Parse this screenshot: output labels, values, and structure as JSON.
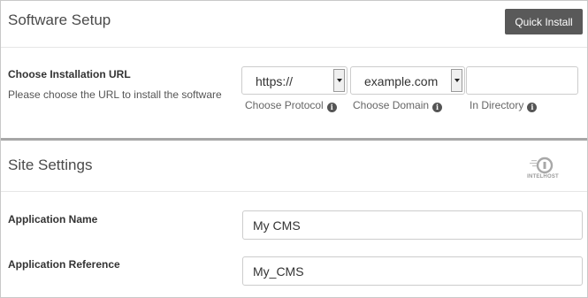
{
  "software_setup": {
    "title": "Software Setup",
    "quick_install_label": "Quick Install"
  },
  "installation_url": {
    "label": "Choose Installation URL",
    "description": "Please choose the URL to install the software",
    "protocol_value": "https://",
    "protocol_label": "Choose Protocol",
    "domain_value": "example.com",
    "domain_label": "Choose Domain",
    "directory_value": "",
    "directory_label": "In Directory"
  },
  "site_settings": {
    "title": "Site Settings",
    "logo_text": "INTELHOST",
    "app_name_label": "Application Name",
    "app_name_value": "My CMS",
    "app_reference_label": "Application Reference",
    "app_reference_value": "My_CMS"
  },
  "icons": {
    "info": "info-circle-icon",
    "dropdown": "dropdown-arrow-icon",
    "logo": "intelhost-logo-icon"
  },
  "colors": {
    "button_bg": "#595959",
    "button_text": "#ffffff",
    "section_divider": "#a6a6a6",
    "border": "#cccccc"
  }
}
